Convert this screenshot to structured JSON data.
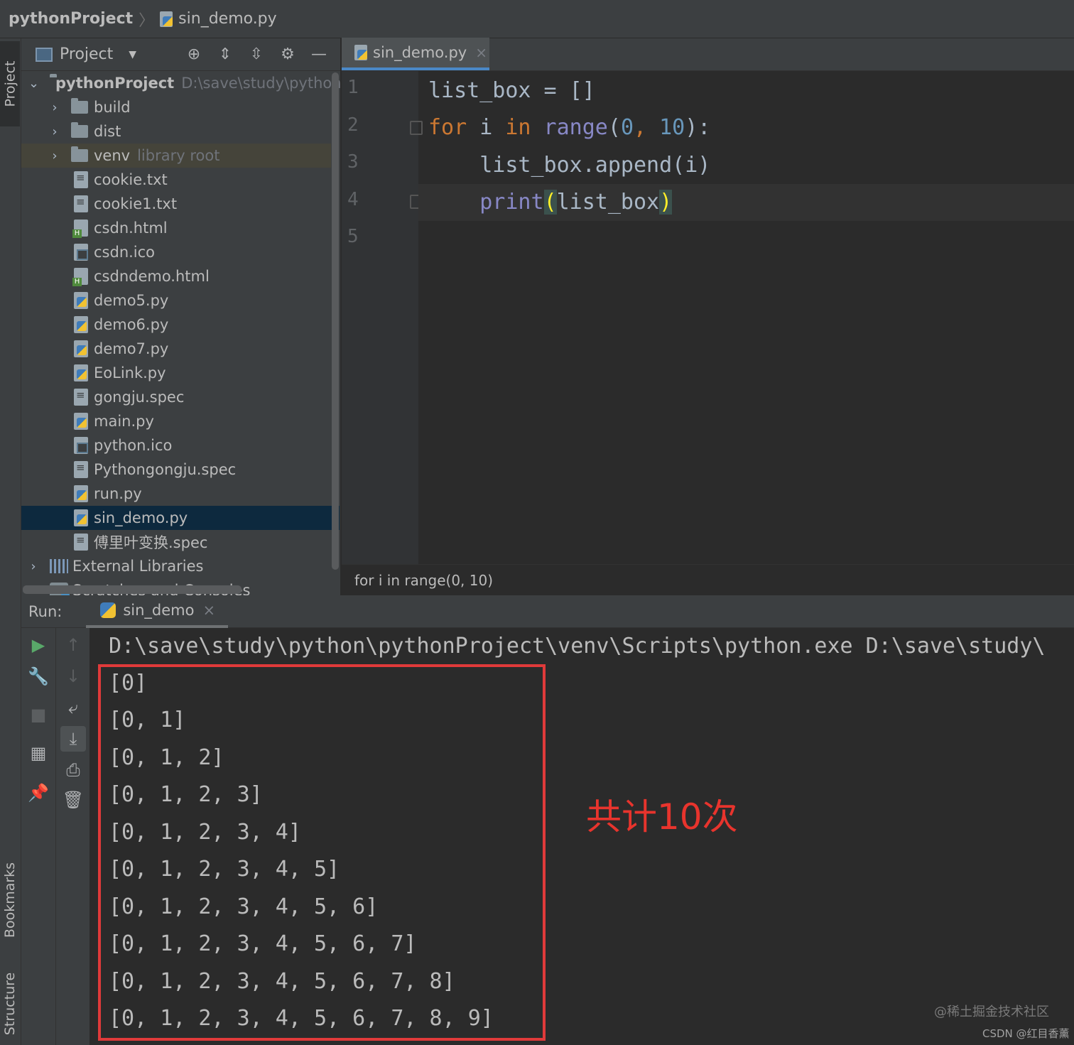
{
  "breadcrumb": {
    "project": "pythonProject",
    "file": "sin_demo.py"
  },
  "side_tabs": {
    "project": "Project",
    "bookmarks": "Bookmarks",
    "structure": "Structure"
  },
  "project_panel": {
    "title": "Project",
    "tree": [
      {
        "label": "pythonProject",
        "hint": "D:\\save\\study\\python\\",
        "type": "root"
      },
      {
        "label": "build",
        "type": "folder"
      },
      {
        "label": "dist",
        "type": "folder"
      },
      {
        "label": "venv",
        "hint": "library root",
        "type": "folder-lib"
      },
      {
        "label": "cookie.txt",
        "type": "txt"
      },
      {
        "label": "cookie1.txt",
        "type": "txt"
      },
      {
        "label": "csdn.html",
        "type": "html"
      },
      {
        "label": "csdn.ico",
        "type": "ico"
      },
      {
        "label": "csdndemo.html",
        "type": "html"
      },
      {
        "label": "demo5.py",
        "type": "py"
      },
      {
        "label": "demo6.py",
        "type": "py"
      },
      {
        "label": "demo7.py",
        "type": "py"
      },
      {
        "label": "EoLink.py",
        "type": "py"
      },
      {
        "label": "gongju.spec",
        "type": "txt"
      },
      {
        "label": "main.py",
        "type": "py"
      },
      {
        "label": "python.ico",
        "type": "ico"
      },
      {
        "label": "Pythongongju.spec",
        "type": "txt"
      },
      {
        "label": "run.py",
        "type": "py"
      },
      {
        "label": "sin_demo.py",
        "type": "py",
        "selected": true
      },
      {
        "label": "傅里叶变换.spec",
        "type": "txt"
      },
      {
        "label": "External Libraries",
        "type": "libs"
      },
      {
        "label": "Scratches and Consoles",
        "type": "scratch"
      }
    ]
  },
  "editor": {
    "tab": "sin_demo.py",
    "line_numbers": [
      "1",
      "2",
      "3",
      "4",
      "5"
    ],
    "code": {
      "l1": "list_box = []",
      "l2_for": "for",
      "l2_i": " i ",
      "l2_in": "in",
      "l2_range": " range",
      "l2_open": "(",
      "l2_zero": "0",
      "l2_comma": ", ",
      "l2_ten": "10",
      "l2_close": "):",
      "l3": "    list_box.append(i)",
      "l4_indent": "    ",
      "l4_print": "print",
      "l4_open": "(",
      "l4_arg": "list_box",
      "l4_close": ")"
    },
    "breadcrumb": "for i in range(0, 10)"
  },
  "run": {
    "label": "Run:",
    "tab": "sin_demo",
    "command": "D:\\save\\study\\python\\pythonProject\\venv\\Scripts\\python.exe D:\\save\\study\\",
    "output": [
      "[0]",
      "[0, 1]",
      "[0, 1, 2]",
      "[0, 1, 2, 3]",
      "[0, 1, 2, 3, 4]",
      "[0, 1, 2, 3, 4, 5]",
      "[0, 1, 2, 3, 4, 5, 6]",
      "[0, 1, 2, 3, 4, 5, 6, 7]",
      "[0, 1, 2, 3, 4, 5, 6, 7, 8]",
      "[0, 1, 2, 3, 4, 5, 6, 7, 8, 9]"
    ],
    "annotation": "共计10次",
    "annotation_color": "#e8342d"
  },
  "watermarks": {
    "juejin": "@稀土掘金技术社区",
    "csdn": "CSDN @红目香薰"
  },
  "colors": {
    "keyword": "#cc7832",
    "builtin": "#8888c6",
    "number": "#6897bb",
    "selection": "#0d293e",
    "tab_underline": "#4a88c7"
  }
}
